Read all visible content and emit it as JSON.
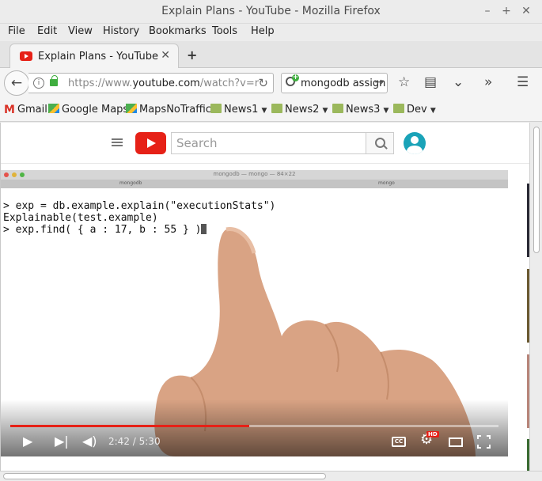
{
  "window": {
    "title": "Explain Plans - YouTube - Mozilla Firefox"
  },
  "menubar": [
    "File",
    "Edit",
    "View",
    "History",
    "Bookmarks",
    "Tools",
    "Help"
  ],
  "tab": {
    "label": "Explain Plans - YouTube",
    "close": "✕",
    "new_tab": "+"
  },
  "navbar": {
    "url_prefix": "https://www.",
    "url_host": "youtube.com",
    "url_path": "/watch?v=r",
    "search_text": "mongodb assign"
  },
  "bookmarks": {
    "gmail": "Gmail",
    "google_maps": "Google Maps",
    "maps_no_traffic": "MapsNoTraffic",
    "news1": "News1",
    "news2": "News2",
    "news3": "News3",
    "dev": "Dev"
  },
  "youtube": {
    "search_placeholder": "Search"
  },
  "video": {
    "terminal_title": "mongodb — mongo — 84×22",
    "terminal_tab_left": "mongodb",
    "terminal_tab_right": "mongo",
    "code_line1": "> exp = db.example.explain(\"executionStats\")",
    "code_line2": "Explainable(test.example)",
    "code_line3": "> exp.find( { a : 17, b : 55 } )",
    "time_current": "2:42",
    "time_sep": " / ",
    "time_total": "5:30",
    "progress_fraction": 0.49,
    "cc_label": "CC",
    "hd_label": "HD"
  },
  "colors": {
    "youtube_red": "#e62117",
    "avatar_teal": "#1aa3b8"
  }
}
